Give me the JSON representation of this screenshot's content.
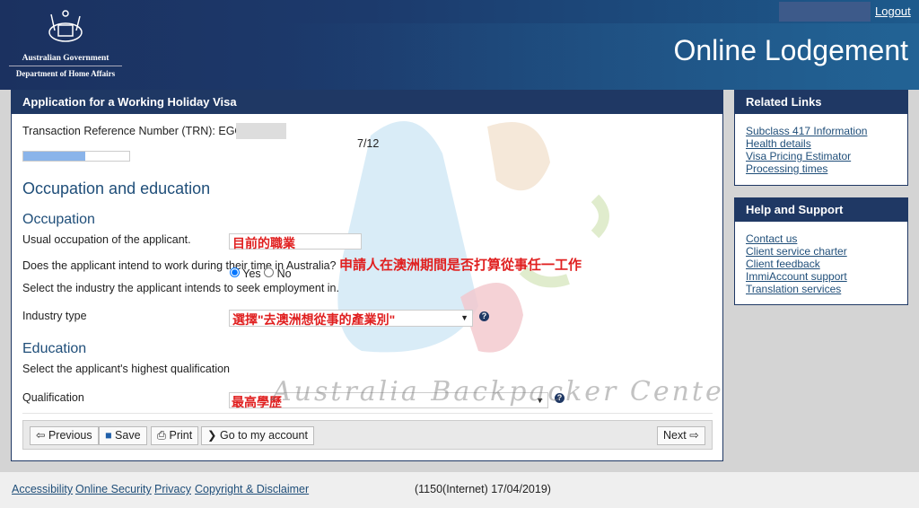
{
  "header": {
    "logo_line1": "Australian Government",
    "logo_line2": "Department of Home Affairs",
    "logout": "Logout",
    "title": "Online Lodgement"
  },
  "main": {
    "title": "Application for a Working Holiday Visa",
    "trn_label": "Transaction Reference Number (TRN): EGO",
    "step": "7/12",
    "progress": 0.583,
    "section": "Occupation and education",
    "occupation": {
      "heading": "Occupation",
      "usual_label": "Usual occupation of the applicant.",
      "usual_value": "目前的職業",
      "work_question": "Does the applicant intend to work during their time in Australia?",
      "work_annotation": "申請人在澳洲期間是否打算從事任一工作",
      "yes": "Yes",
      "no": "No",
      "selected": "Yes",
      "industry_prompt": "Select the industry the applicant intends to seek employment in.",
      "industry_label": "Industry type",
      "industry_value": "選擇\"去澳洲想從事的產業別\""
    },
    "education": {
      "heading": "Education",
      "prompt": "Select the applicant's highest qualification",
      "qual_label": "Qualification",
      "qual_value": "最高學歷"
    },
    "buttons": {
      "previous": "Previous",
      "save": "Save",
      "print": "Print",
      "account": "Go to my account",
      "next": "Next"
    },
    "watermark": "Australia Backpacker Center"
  },
  "related": {
    "title": "Related Links",
    "links": [
      "Subclass 417 Information",
      "Health details",
      "Visa Pricing Estimator",
      "Processing times"
    ]
  },
  "help": {
    "title": "Help and Support",
    "links": [
      "Contact us",
      "Client service charter",
      "Client feedback",
      "ImmiAccount support",
      "Translation services"
    ]
  },
  "footer": {
    "links": [
      "Accessibility",
      "Online Security",
      "Privacy",
      "Copyright & Disclaimer"
    ],
    "version": "(1150(Internet) 17/04/2019)"
  }
}
